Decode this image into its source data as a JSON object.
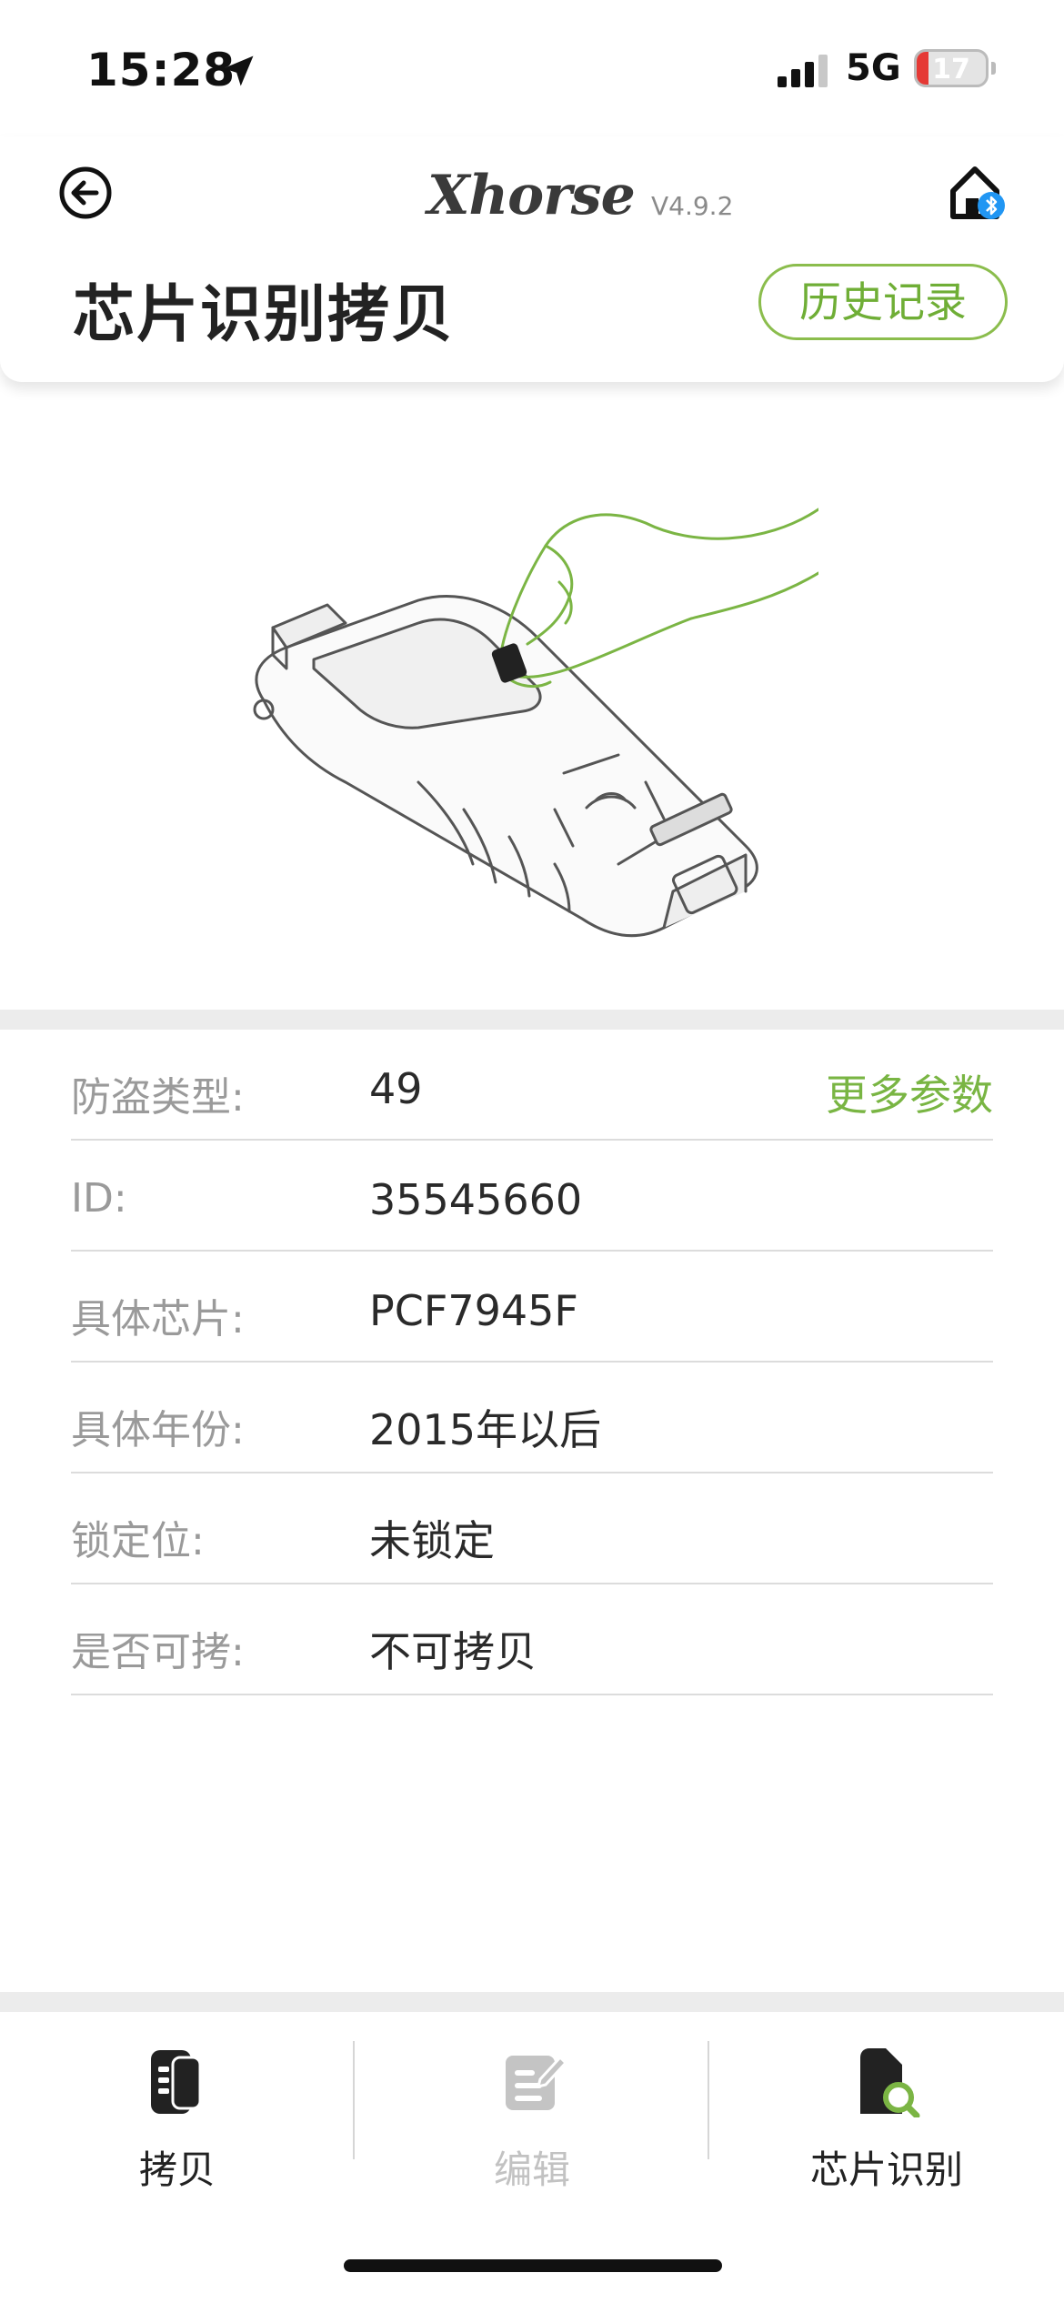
{
  "status_bar": {
    "time": "15:28",
    "network": "5G",
    "battery": "17",
    "icons": [
      "location-arrow-icon",
      "signal-bars-icon",
      "battery-icon"
    ]
  },
  "header": {
    "logo": "Xhorse",
    "version": "V4.9.2",
    "title": "芯片识别拷贝",
    "history_button": "历史记录",
    "icons": [
      "back-arrow-icon",
      "home-bluetooth-icon"
    ]
  },
  "illustration": {
    "description_icon": "device-hand-chip-illustration"
  },
  "info": {
    "more_params": "更多参数",
    "rows": [
      {
        "label": "防盗类型:",
        "value": "49"
      },
      {
        "label": "ID:",
        "value": "35545660"
      },
      {
        "label": "具体芯片:",
        "value": "PCF7945F"
      },
      {
        "label": "具体年份:",
        "value": "2015年以后"
      },
      {
        "label": "锁定位:",
        "value": "未锁定"
      },
      {
        "label": "是否可拷:",
        "value": "不可拷贝"
      }
    ]
  },
  "bottom_nav": {
    "items": [
      {
        "label": "拷贝",
        "icon": "car-key-icon",
        "enabled": true
      },
      {
        "label": "编辑",
        "icon": "edit-icon",
        "enabled": false
      },
      {
        "label": "芯片识别",
        "icon": "chip-search-icon",
        "enabled": true,
        "active": true
      }
    ]
  },
  "colors": {
    "accent_green": "#79b543",
    "battery_low": "#e53935",
    "separator": "#ececec"
  }
}
